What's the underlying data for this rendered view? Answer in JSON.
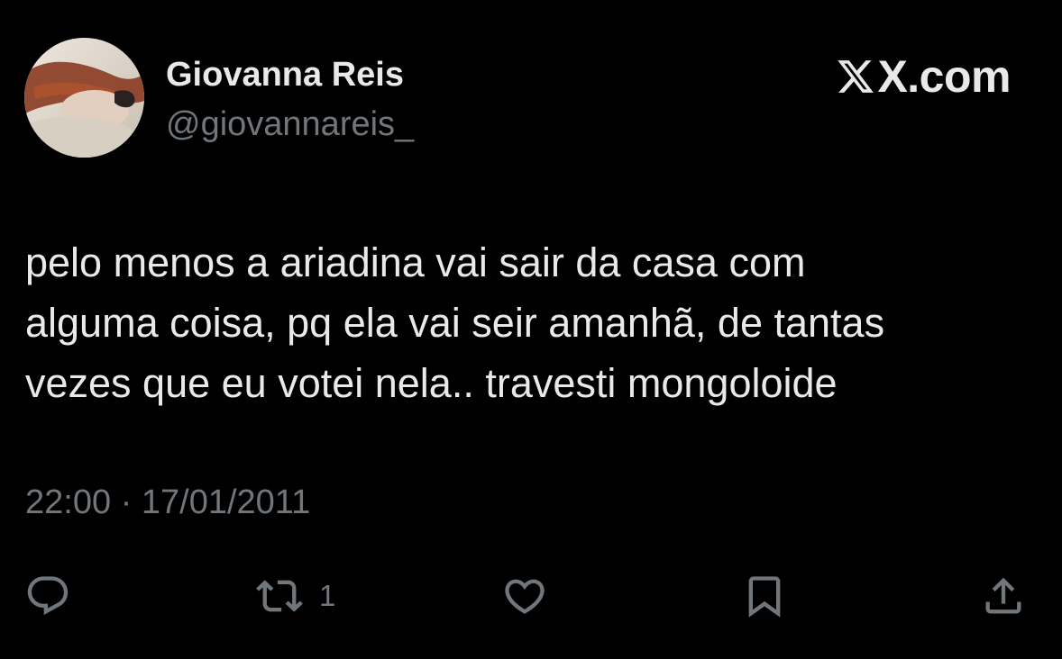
{
  "author": {
    "display_name": "Giovanna Reis",
    "handle": "@giovannareis_"
  },
  "brand": {
    "logo": "x-logo-icon",
    "text": "X.com"
  },
  "tweet": {
    "lines": [
      "pelo menos a ariadina vai sair da casa com",
      "alguma coisa, pq ela vai seir amanhã, de tantas",
      "vezes que eu votei nela.. travesti mongoloide"
    ],
    "time": "22:00",
    "separator": "·",
    "date": "17/01/2011"
  },
  "actions": {
    "reply": {
      "icon": "reply-icon",
      "count": ""
    },
    "retweet": {
      "icon": "retweet-icon",
      "count": "1"
    },
    "like": {
      "icon": "heart-icon",
      "count": ""
    },
    "bookmark": {
      "icon": "bookmark-icon",
      "count": ""
    },
    "share": {
      "icon": "share-icon",
      "count": ""
    }
  },
  "colors": {
    "background": "#000000",
    "primary_text": "#e7e9ea",
    "secondary_text": "#71767b"
  }
}
